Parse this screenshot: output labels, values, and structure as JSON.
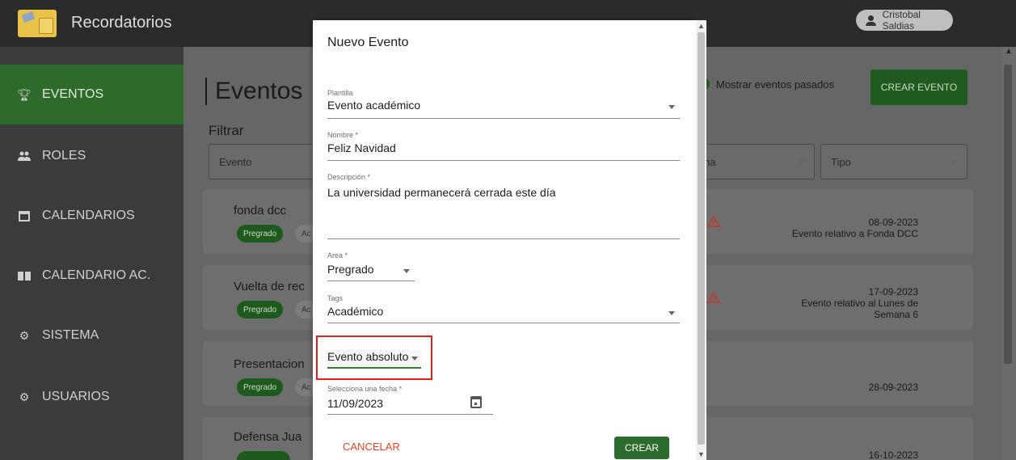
{
  "app": {
    "title": "Recordatorios",
    "user": "Cristobal Saldias"
  },
  "sidebar": {
    "items": [
      {
        "label": "EVENTOS",
        "icon": "trophy-icon"
      },
      {
        "label": "ROLES",
        "icon": "people-icon"
      },
      {
        "label": "CALENDARIOS",
        "icon": "calendar-icon"
      },
      {
        "label": "CALENDARIO AC.",
        "icon": "book-icon"
      },
      {
        "label": "SISTEMA",
        "icon": "gear-icon"
      },
      {
        "label": "USUARIOS",
        "icon": "gear-icon"
      }
    ]
  },
  "main": {
    "title": "Eventos",
    "show_past": "Mostrar eventos pasados",
    "create_button": "CREAR EVENTO",
    "filter_title": "Filtrar",
    "filters": {
      "evento": "Evento",
      "area_partial": "na",
      "tipo": "Tipo"
    },
    "events": [
      {
        "title": "fonda dcc",
        "chip1": "Pregrado",
        "chip2": "Ac",
        "date": "08-09-2023",
        "desc": "Evento relativo a Fonda DCC"
      },
      {
        "title": "Vuelta de rec",
        "chip1": "Pregrado",
        "chip2": "Ac",
        "date": "17-09-2023",
        "desc_line1": "Evento relativo al Lunes de",
        "desc_line2": "Semana 6"
      },
      {
        "title": "Presentacion",
        "chip1": "Pregrado",
        "chip2": "Ac",
        "date": "28-09-2023"
      },
      {
        "title": "Defensa Jua",
        "date": "16-10-2023"
      }
    ]
  },
  "dialog": {
    "title": "Nuevo Evento",
    "plantilla_label": "Plantilla",
    "plantilla_value": "Evento académico",
    "nombre_label": "Nombre *",
    "nombre_value": "Feliz Navidad",
    "descripcion_label": "Descripción *",
    "descripcion_value": "La universidad permanecerá cerrada este día",
    "area_label": "Area *",
    "area_value": "Pregrado",
    "tags_label": "Tags",
    "tags_value": "Académico",
    "tipo_value": "Evento absoluto",
    "fecha_label": "Selecciona una fecha *",
    "fecha_value": "11/09/2023",
    "cancel": "CANCELAR",
    "create": "CREAR"
  },
  "colors": {
    "accent": "#2d6a2d",
    "cancel": "#e0442a",
    "highlight": "#e02020"
  }
}
